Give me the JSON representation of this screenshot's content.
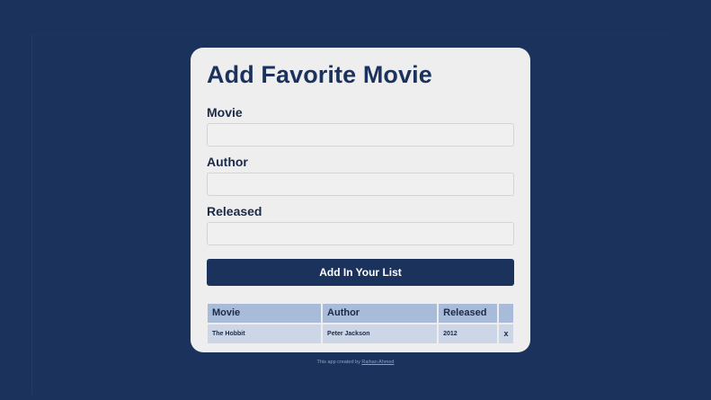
{
  "form": {
    "title": "Add Favorite Movie",
    "movie_label": "Movie",
    "author_label": "Author",
    "released_label": "Released",
    "movie_value": "",
    "author_value": "",
    "released_value": "",
    "submit_label": "Add In Your List"
  },
  "table": {
    "headers": [
      "Movie",
      "Author",
      "Released",
      ""
    ],
    "rows": [
      {
        "movie": "The Hobbit",
        "author": "Peter Jackson",
        "released": "2012",
        "delete": "x"
      }
    ]
  },
  "footer": {
    "text": "This app created by ",
    "link": "Raihan Ahmed"
  },
  "colors": {
    "background": "#1b335c",
    "card": "#efeeee",
    "accent": "#1b335c",
    "table_header": "#a8bbd8",
    "table_row": "#cdd6e6"
  }
}
